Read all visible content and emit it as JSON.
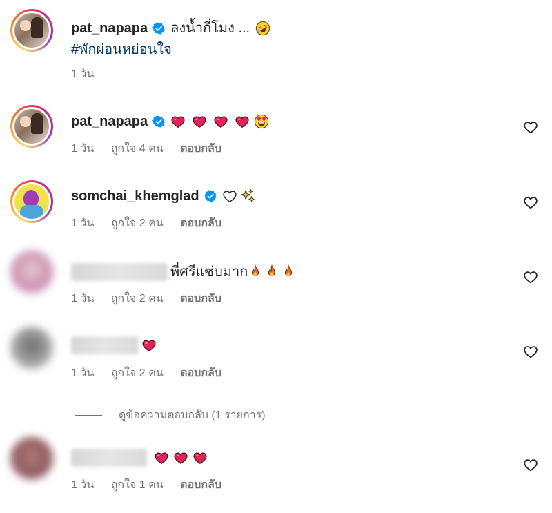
{
  "comments": [
    {
      "username": "pat_napapa",
      "text": "ลงน้ำกี่โมง ...",
      "hashtag": "#พักผ่อนหย่อนใจ",
      "time": "1 วัน",
      "likes": "",
      "reply": "",
      "emojis": [
        "rofl-emoji"
      ]
    },
    {
      "username": "pat_napapa",
      "text": "",
      "time": "1 วัน",
      "likes": "ถูกใจ 4 คน",
      "reply": "ตอบกลับ",
      "emojis": [
        "red-heart-emoji",
        "red-heart-emoji",
        "red-heart-emoji",
        "red-heart-emoji",
        "heart-eyes-emoji"
      ]
    },
    {
      "username": "somchai_khemglad",
      "text": "",
      "time": "1 วัน",
      "likes": "ถูกใจ 2 คน",
      "reply": "ตอบกลับ",
      "emojis": [
        "white-heart-emoji",
        "sparkles-emoji"
      ]
    },
    {
      "username": "",
      "text": "พี่ศรีแซ่บมาก",
      "time": "1 วัน",
      "likes": "ถูกใจ 2 คน",
      "reply": "ตอบกลับ",
      "emojis": [
        "fire-emoji",
        "fire-emoji",
        "fire-emoji"
      ]
    },
    {
      "username": "",
      "text": "",
      "time": "1 วัน",
      "likes": "ถูกใจ 2 คน",
      "reply": "ตอบกลับ",
      "emojis": [
        "red-heart-emoji"
      ]
    },
    {
      "username": "",
      "text": "",
      "time": "1 วัน",
      "likes": "ถูกใจ 1 คน",
      "reply": "ตอบกลับ",
      "emojis": [
        "red-heart-emoji",
        "red-heart-emoji",
        "red-heart-emoji"
      ]
    }
  ],
  "view_replies": "ดูข้อความตอบกลับ (1 รายการ)",
  "colors": {
    "verified": "#0095f6",
    "hashtag": "#00376b",
    "meta": "#737373",
    "heart": "#e0245e"
  }
}
